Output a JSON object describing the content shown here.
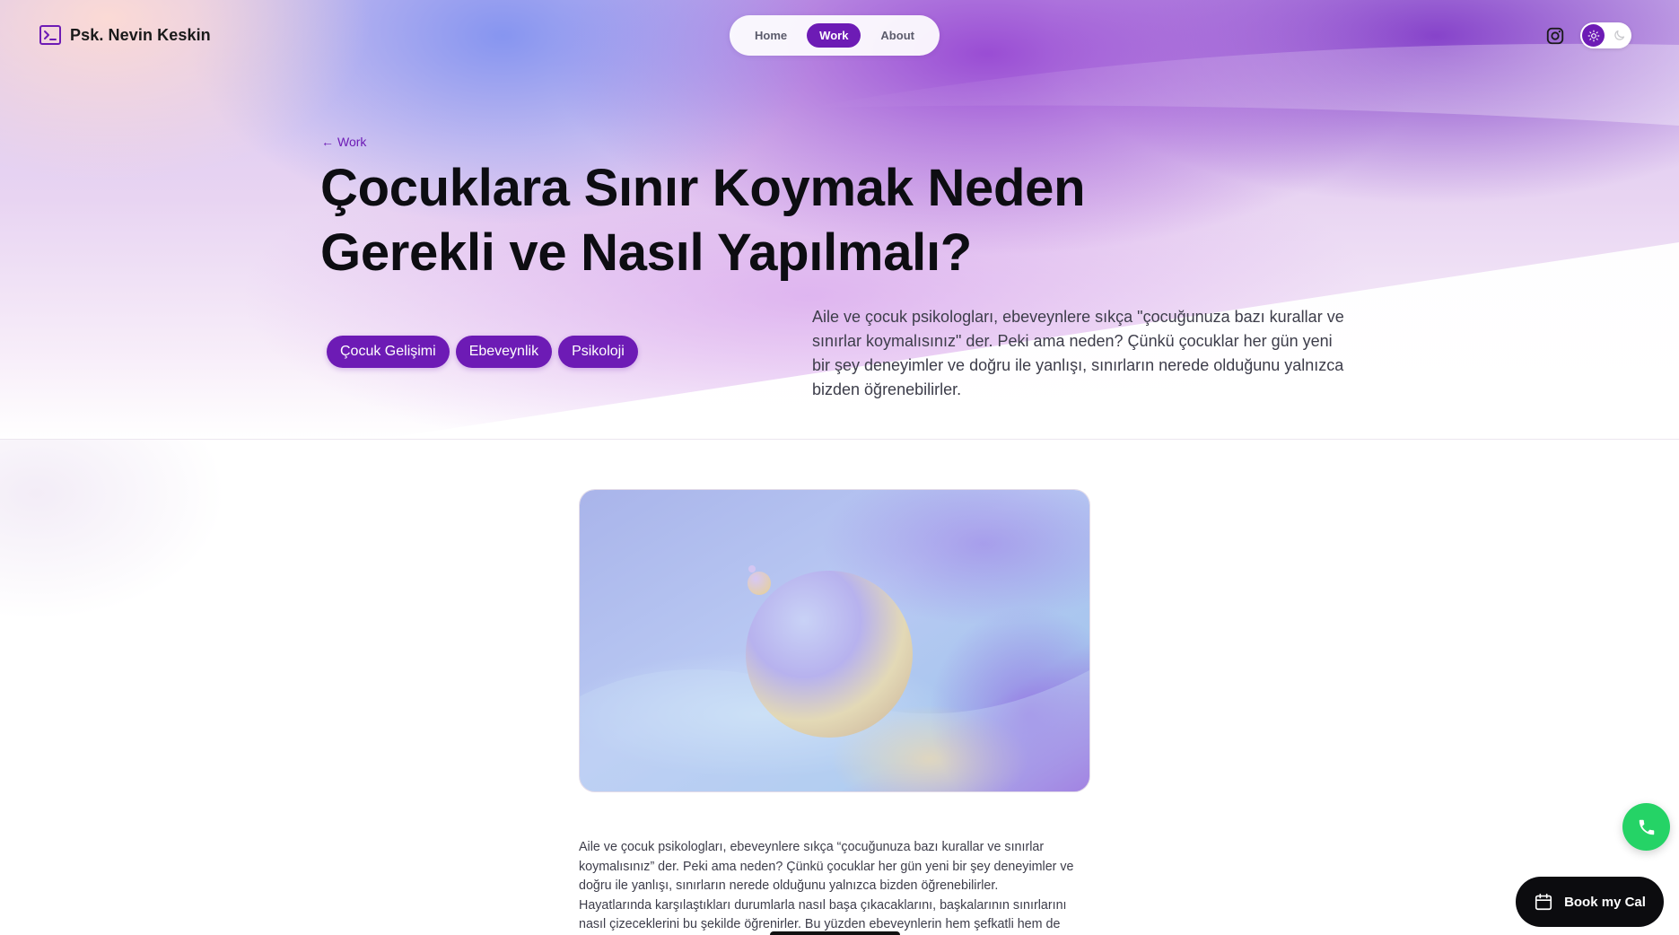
{
  "header": {
    "brand_name": "Psk. Nevin Keskin",
    "nav": [
      {
        "label": "Home",
        "active": false
      },
      {
        "label": "Work",
        "active": true
      },
      {
        "label": "About",
        "active": false
      }
    ]
  },
  "hero": {
    "back_link": "Work",
    "title_line1": "Çocuklara Sınır Koymak Neden",
    "title_line2": "Gerekli ve Nasıl Yapılmalı?",
    "tags": [
      "Çocuk Gelişimi",
      "Ebeveynlik",
      "Psikoloji"
    ],
    "intro": "Aile ve çocuk psikologları, ebeveynlere sıkça \"çocuğunuza bazı kurallar ve sınırlar koymalısınız\" der. Peki ama neden? Çünkü çocuklar her gün yeni bir şey deneyimler ve doğru ile yanlışı, sınırların nerede olduğunu yalnızca bizden öğrenebilirler."
  },
  "article": {
    "lines": [
      "Aile ve çocuk psikologları, ebeveynlere sıkça “çocuğunuza bazı kurallar ve sınırlar",
      "koymalısınız” der. Peki ama neden? Çünkü çocuklar her gün yeni bir şey deneyimler ve",
      "doğru ile yanlışı, sınırların nerede olduğunu yalnızca bizden öğrenebilirler.",
      "Hayatlarında karşılaştıkları durumlarla nasıl başa çıkacaklarını, başkalarının sınırlarını",
      "nasıl çizeceklerini bu şekilde öğrenirler. Bu yüzden ebeveynlerin hem şefkatli hem de"
    ]
  },
  "floating": {
    "book_label": "Book my Cal"
  },
  "colors": {
    "accent": "#6d1bb5",
    "call": "#25d366",
    "book_bg": "#0c0c0f"
  }
}
